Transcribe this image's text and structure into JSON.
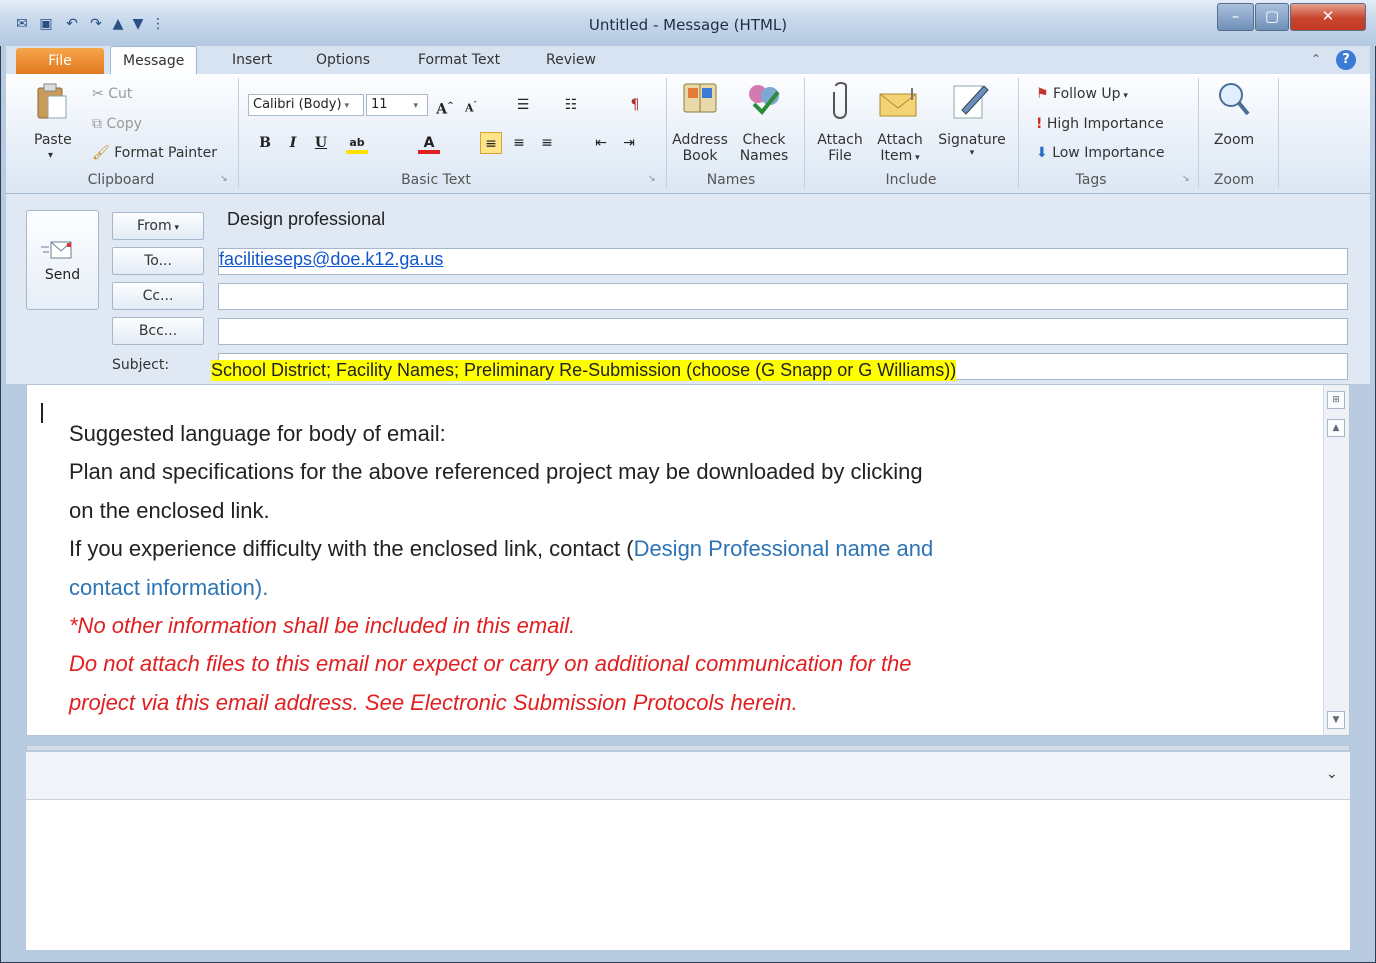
{
  "window": {
    "title": "Untitled  -  Message (HTML)",
    "buttons": {
      "minimize": "–",
      "maximize": "▢",
      "close": "✕"
    }
  },
  "qat": {
    "items": [
      "outlook-icon",
      "save-icon",
      "undo-icon",
      "redo-icon",
      "up-icon",
      "down-icon",
      "customize-icon"
    ]
  },
  "tabs": [
    {
      "label": "File"
    },
    {
      "label": "Message"
    },
    {
      "label": "Insert"
    },
    {
      "label": "Options"
    },
    {
      "label": "Format Text"
    },
    {
      "label": "Review"
    }
  ],
  "ribbon": {
    "clipboard": {
      "paste": "Paste",
      "cut": "Cut",
      "copy": "Copy",
      "format_painter": "Format Painter",
      "label": "Clipboard"
    },
    "basic_text": {
      "font": "Calibri (Body)",
      "size": "11",
      "label": "Basic Text",
      "bold": "B",
      "italic": "I",
      "underline": "U"
    },
    "names": {
      "address_book_1": "Address",
      "address_book_2": "Book",
      "check_names_1": "Check",
      "check_names_2": "Names",
      "label": "Names"
    },
    "include": {
      "attach_file_1": "Attach",
      "attach_file_2": "File",
      "attach_item_1": "Attach",
      "attach_item_2": "Item",
      "signature": "Signature",
      "label": "Include"
    },
    "tags": {
      "follow_up": "Follow Up",
      "high": "High Importance",
      "low": "Low Importance",
      "label": "Tags"
    },
    "zoom": {
      "button": "Zoom",
      "label": "Zoom"
    }
  },
  "header": {
    "send": "Send",
    "from_btn": "From",
    "from_value": "Design professional",
    "to_btn": "To...",
    "to_value": "facilitieseps@doe.k12.ga.us",
    "cc_btn": "Cc...",
    "bcc_btn": "Bcc...",
    "subject_label": "Subject:",
    "subject_value": "School District; Facility Names; Preliminary  Re-Submission (choose (G Snapp or G Williams))"
  },
  "body": {
    "line1": "Suggested language for body of email:",
    "line2": "Plan and specifications for the above referenced project may be downloaded by clicking",
    "line3": "on the enclosed link.",
    "line4a": "If you experience difficulty with the enclosed link, contact (",
    "line4b": "Design Professional name and",
    "line5": "contact information).",
    "line6": "*No other information shall be included in this email.",
    "line7": "Do not attach files to this email nor expect or carry on additional communication for the",
    "line8": "project via this email address. See Electronic Submission Protocols herein."
  },
  "colors": {
    "accent_file_tab": "#e1781f",
    "link_blue": "#1155cc",
    "info_blue": "#2e74b5",
    "warning_red": "#e02020",
    "highlight": "#ffff00"
  }
}
